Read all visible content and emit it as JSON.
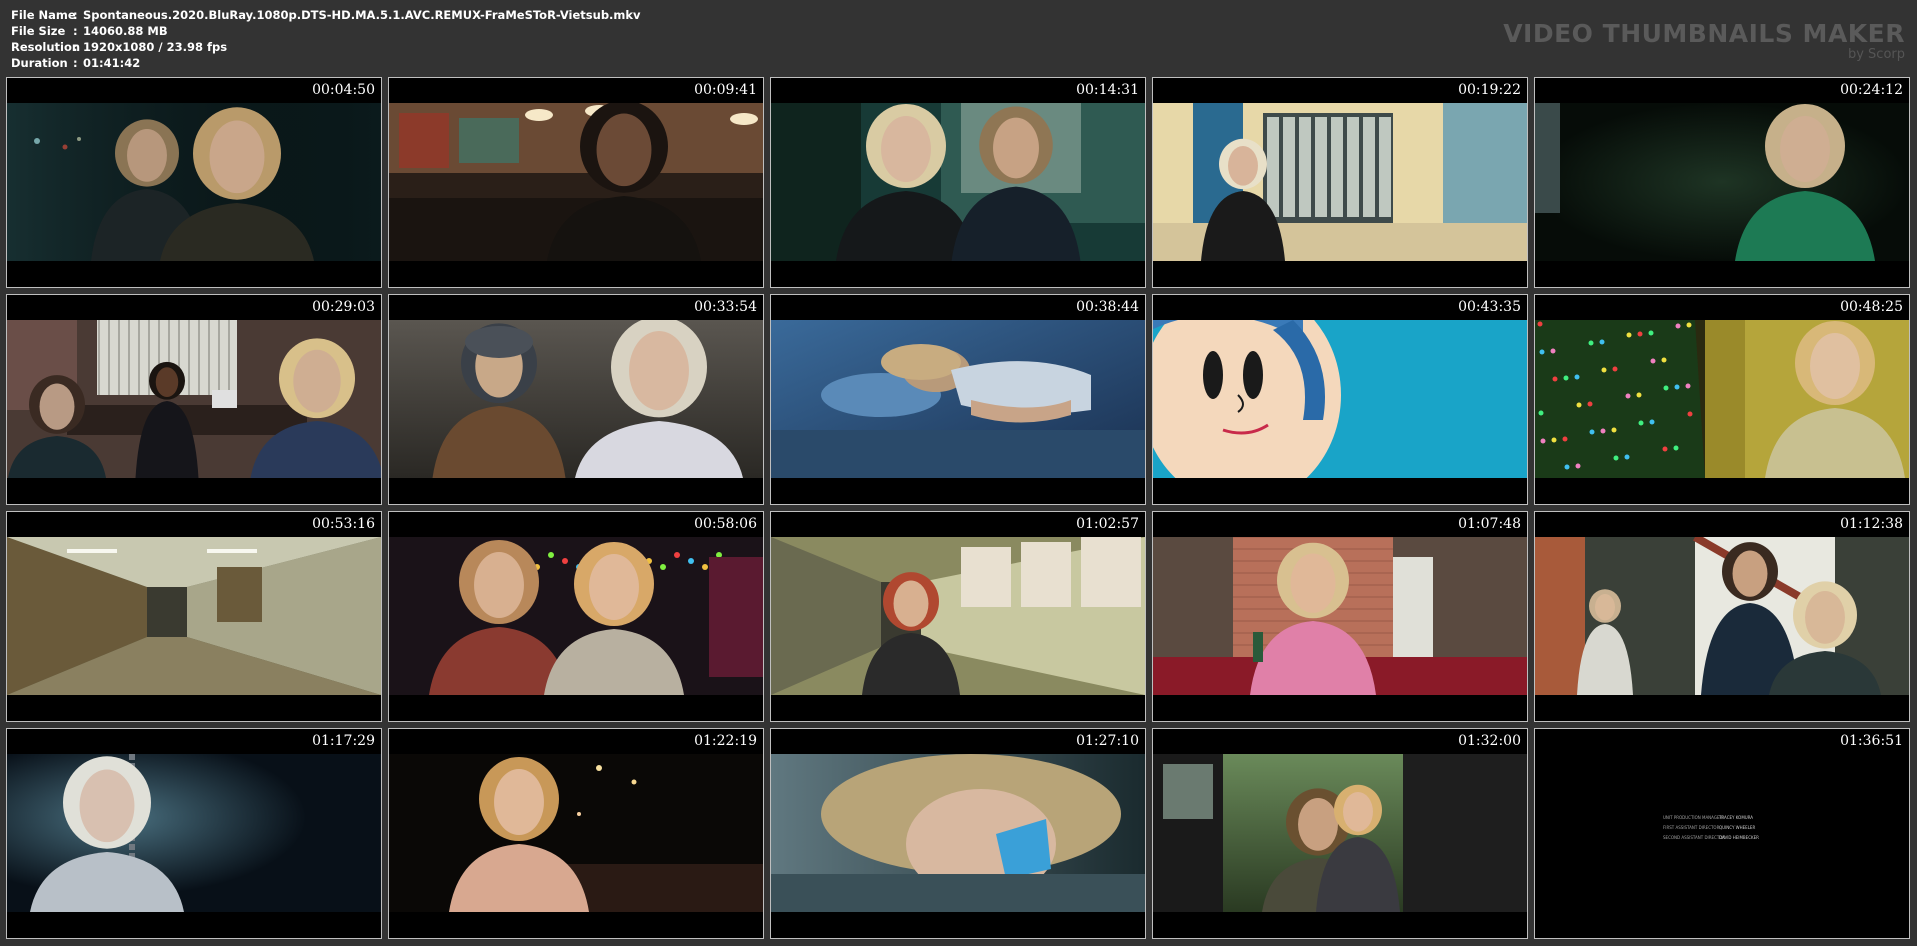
{
  "header": {
    "file_name_label": "File Name",
    "file_name": "Spontaneous.2020.BluRay.1080p.DTS-HD.MA.5.1.AVC.REMUX-FraMeSToR-Vietsub.mkv",
    "file_size_label": "File Size",
    "file_size": "14060.88 MB",
    "resolution_label": "Resolution",
    "resolution": "1920x1080 / 23.98 fps",
    "duration_label": "Duration",
    "duration": "01:41:42",
    "separator": ":"
  },
  "brand": {
    "title": "VIDEO THUMBNAILS MAKER",
    "subtitle": "by Scorp"
  },
  "thumbnails": [
    {
      "time": "00:04:50",
      "scene": "two-women-night-teal"
    },
    {
      "time": "00:09:41",
      "scene": "diner-interior-warm"
    },
    {
      "time": "00:14:31",
      "scene": "couple-outside-house-night"
    },
    {
      "time": "00:19:22",
      "scene": "school-hallway-lockers"
    },
    {
      "time": "00:24:12",
      "scene": "girl-green-jacket-woods"
    },
    {
      "time": "00:29:03",
      "scene": "office-meeting"
    },
    {
      "time": "00:33:54",
      "scene": "couple-forest-overcast"
    },
    {
      "time": "00:38:44",
      "scene": "boy-lying-bed-blue"
    },
    {
      "time": "00:43:35",
      "scene": "cartoon-face-blue"
    },
    {
      "time": "00:48:25",
      "scene": "girl-christmas-tree"
    },
    {
      "time": "00:53:16",
      "scene": "empty-school-hallway"
    },
    {
      "time": "00:58:06",
      "scene": "couple-close-fairy-lights"
    },
    {
      "time": "01:02:57",
      "scene": "girl-running-hallway"
    },
    {
      "time": "01:07:48",
      "scene": "girl-pink-robe-kitchen"
    },
    {
      "time": "01:12:38",
      "scene": "living-room-family"
    },
    {
      "time": "01:17:29",
      "scene": "girl-on-swing-night"
    },
    {
      "time": "01:22:19",
      "scene": "girl-street-night"
    },
    {
      "time": "01:27:10",
      "scene": "girl-lying-closeup"
    },
    {
      "time": "01:32:00",
      "scene": "people-by-truck-forest"
    },
    {
      "time": "01:36:51",
      "scene": "end-credits"
    }
  ],
  "credits": [
    {
      "role": "UNIT PRODUCTION MANAGER",
      "name": "TRACEY KOMURA"
    },
    {
      "role": "FIRST ASSISTANT DIRECTOR",
      "name": "QUINCY WHEELER"
    },
    {
      "role": "SECOND ASSISTANT DIRECTOR",
      "name": "DAVID HEIMBECKER"
    }
  ]
}
